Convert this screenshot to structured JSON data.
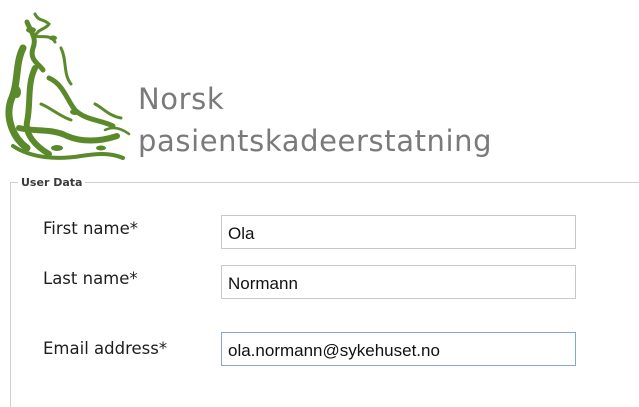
{
  "logo": {
    "line1": "Norsk",
    "line2": "pasientskadeerstatning"
  },
  "form": {
    "legend": "User Data",
    "fields": [
      {
        "label": "First name*",
        "value": "Ola"
      },
      {
        "label": "Last name*",
        "value": "Normann"
      },
      {
        "label": "Email address*",
        "value": "ola.normann@sykehuset.no"
      }
    ]
  },
  "colors": {
    "logo_green": "#5a8a2a",
    "logo_text": "#7a7a7a",
    "focus_border": "#7fa8d9"
  }
}
